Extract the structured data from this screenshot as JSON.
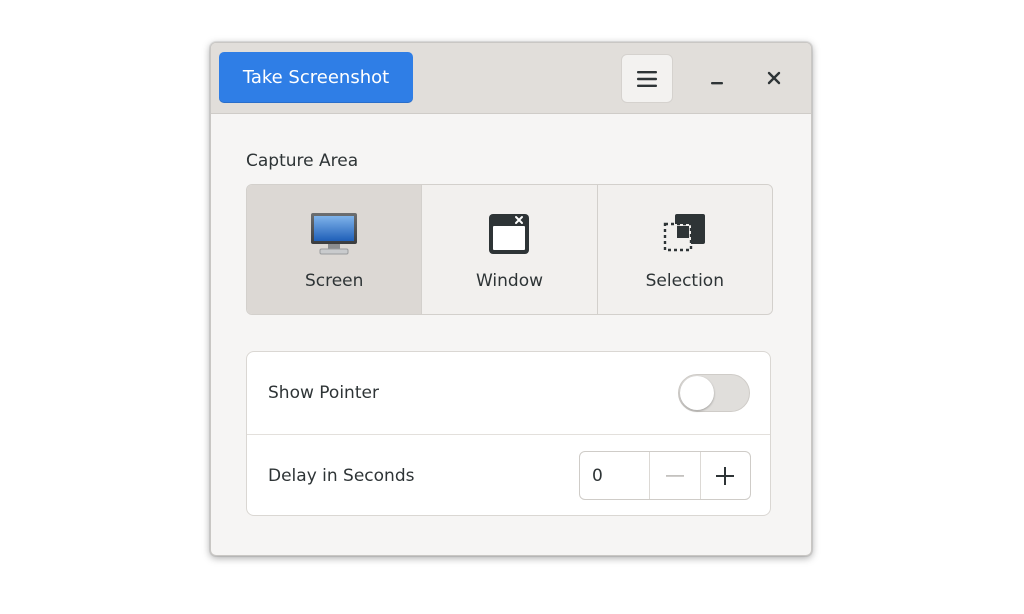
{
  "header": {
    "take_screenshot_label": "Take Screenshot",
    "menu_icon": "hamburger-menu-icon",
    "minimize_icon": "minimize-icon",
    "close_icon": "close-icon",
    "accent_color": "#2f7ee6"
  },
  "capture_area": {
    "title": "Capture Area",
    "options": [
      {
        "label": "Screen",
        "icon": "monitor-icon",
        "selected": true
      },
      {
        "label": "Window",
        "icon": "window-icon",
        "selected": false
      },
      {
        "label": "Selection",
        "icon": "selection-icon",
        "selected": false
      }
    ]
  },
  "options": {
    "show_pointer": {
      "label": "Show Pointer",
      "enabled": false
    },
    "delay": {
      "label": "Delay in Seconds",
      "value": "0"
    }
  }
}
